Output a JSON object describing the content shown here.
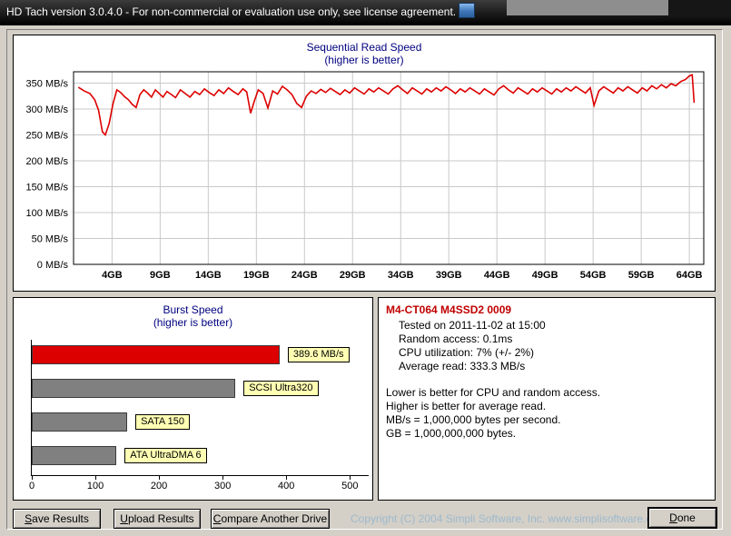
{
  "window": {
    "title": "HD Tach version 3.0.4.0  - For non-commercial or evaluation use only, see license agreement."
  },
  "chart_data": [
    {
      "type": "line",
      "title": "Sequential Read Speed",
      "subtitle": "(higher is better)",
      "color": "#dd0000",
      "ylim": [
        0,
        372
      ],
      "xlim": [
        0,
        65.5
      ],
      "yticks": [
        0,
        50,
        100,
        150,
        200,
        250,
        300,
        350
      ],
      "ytick_suffix": " MB/s",
      "xticks": [
        4,
        9,
        14,
        19,
        24,
        29,
        34,
        39,
        44,
        49,
        54,
        59,
        64
      ],
      "xtick_suffix": "GB",
      "grid": true,
      "points": [
        [
          0.5,
          342
        ],
        [
          1.1,
          335
        ],
        [
          1.7,
          330
        ],
        [
          2.2,
          318
        ],
        [
          2.6,
          298
        ],
        [
          3.0,
          256
        ],
        [
          3.3,
          250
        ],
        [
          3.7,
          272
        ],
        [
          4.1,
          310
        ],
        [
          4.5,
          337
        ],
        [
          4.9,
          332
        ],
        [
          5.3,
          324
        ],
        [
          5.7,
          318
        ],
        [
          6.1,
          309
        ],
        [
          6.5,
          303
        ],
        [
          6.9,
          328
        ],
        [
          7.3,
          337
        ],
        [
          7.7,
          331
        ],
        [
          8.1,
          323
        ],
        [
          8.5,
          337
        ],
        [
          8.9,
          330
        ],
        [
          9.3,
          323
        ],
        [
          9.7,
          334
        ],
        [
          10.1,
          329
        ],
        [
          10.6,
          322
        ],
        [
          11.1,
          337
        ],
        [
          11.6,
          330
        ],
        [
          12.1,
          323
        ],
        [
          12.6,
          334
        ],
        [
          13.1,
          328
        ],
        [
          13.6,
          339
        ],
        [
          14.1,
          332
        ],
        [
          14.6,
          326
        ],
        [
          15.1,
          337
        ],
        [
          15.6,
          330
        ],
        [
          16.1,
          341
        ],
        [
          16.6,
          334
        ],
        [
          17.1,
          328
        ],
        [
          17.6,
          339
        ],
        [
          18.0,
          333
        ],
        [
          18.4,
          292
        ],
        [
          18.8,
          316
        ],
        [
          19.2,
          337
        ],
        [
          19.7,
          330
        ],
        [
          20.2,
          302
        ],
        [
          20.7,
          335
        ],
        [
          21.2,
          329
        ],
        [
          21.7,
          344
        ],
        [
          22.2,
          337
        ],
        [
          22.7,
          328
        ],
        [
          23.2,
          311
        ],
        [
          23.7,
          303
        ],
        [
          24.2,
          325
        ],
        [
          24.7,
          335
        ],
        [
          25.2,
          330
        ],
        [
          25.7,
          338
        ],
        [
          26.2,
          332
        ],
        [
          26.7,
          340
        ],
        [
          27.2,
          334
        ],
        [
          27.7,
          328
        ],
        [
          28.2,
          337
        ],
        [
          28.7,
          331
        ],
        [
          29.2,
          341
        ],
        [
          29.7,
          335
        ],
        [
          30.2,
          329
        ],
        [
          30.7,
          339
        ],
        [
          31.2,
          333
        ],
        [
          31.7,
          341
        ],
        [
          32.2,
          335
        ],
        [
          32.7,
          329
        ],
        [
          33.2,
          339
        ],
        [
          33.7,
          345
        ],
        [
          34.2,
          337
        ],
        [
          34.7,
          330
        ],
        [
          35.2,
          341
        ],
        [
          35.7,
          335
        ],
        [
          36.2,
          329
        ],
        [
          36.7,
          339
        ],
        [
          37.2,
          333
        ],
        [
          37.7,
          341
        ],
        [
          38.2,
          335
        ],
        [
          38.7,
          343
        ],
        [
          39.2,
          337
        ],
        [
          39.7,
          330
        ],
        [
          40.2,
          339
        ],
        [
          40.7,
          333
        ],
        [
          41.2,
          341
        ],
        [
          41.7,
          335
        ],
        [
          42.2,
          329
        ],
        [
          42.7,
          339
        ],
        [
          43.2,
          333
        ],
        [
          43.7,
          327
        ],
        [
          44.2,
          339
        ],
        [
          44.7,
          345
        ],
        [
          45.2,
          337
        ],
        [
          45.7,
          331
        ],
        [
          46.2,
          341
        ],
        [
          46.7,
          335
        ],
        [
          47.2,
          329
        ],
        [
          47.7,
          339
        ],
        [
          48.2,
          333
        ],
        [
          48.7,
          341
        ],
        [
          49.2,
          335
        ],
        [
          49.7,
          329
        ],
        [
          50.2,
          339
        ],
        [
          50.7,
          333
        ],
        [
          51.2,
          341
        ],
        [
          51.7,
          335
        ],
        [
          52.2,
          343
        ],
        [
          52.7,
          337
        ],
        [
          53.2,
          331
        ],
        [
          53.7,
          341
        ],
        [
          54.1,
          307
        ],
        [
          54.6,
          335
        ],
        [
          55.1,
          343
        ],
        [
          55.6,
          337
        ],
        [
          56.1,
          331
        ],
        [
          56.6,
          341
        ],
        [
          57.1,
          335
        ],
        [
          57.6,
          343
        ],
        [
          58.1,
          337
        ],
        [
          58.6,
          331
        ],
        [
          59.1,
          341
        ],
        [
          59.6,
          335
        ],
        [
          60.1,
          345
        ],
        [
          60.6,
          339
        ],
        [
          61.1,
          347
        ],
        [
          61.6,
          341
        ],
        [
          62.1,
          349
        ],
        [
          62.6,
          345
        ],
        [
          63.1,
          353
        ],
        [
          63.6,
          357
        ],
        [
          64.0,
          364
        ],
        [
          64.3,
          366
        ],
        [
          64.5,
          312
        ]
      ]
    },
    {
      "type": "bar",
      "orientation": "horizontal",
      "title": "Burst Speed",
      "subtitle": "(higher is better)",
      "xlim": [
        0,
        531
      ],
      "xticks": [
        0,
        100,
        200,
        300,
        400,
        500
      ],
      "bars": [
        {
          "label": "389.6 MB/s",
          "value": 389.6,
          "color": "#dd0000"
        },
        {
          "label": "SCSI Ultra320",
          "value": 320,
          "color": "#808080"
        },
        {
          "label": "SATA 150",
          "value": 150,
          "color": "#808080"
        },
        {
          "label": "ATA UltraDMA 6",
          "value": 133,
          "color": "#808080"
        }
      ]
    }
  ],
  "drive_info": {
    "model": "M4-CT064 M4SSD2 0009",
    "tested": "Tested on 2011-11-02 at 15:00",
    "random_access": "Random access: 0.1ms",
    "cpu_utilization": "CPU utilization: 7% (+/- 2%)",
    "average_read": "Average read: 333.3 MB/s",
    "notes": [
      "Lower is better for CPU and random access.",
      "Higher is better for average read.",
      "MB/s = 1,000,000 bytes per second.",
      "GB = 1,000,000,000 bytes."
    ]
  },
  "buttons": {
    "save": {
      "u": "S",
      "rest": "ave Results"
    },
    "upload": {
      "u": "U",
      "rest": "pload Results"
    },
    "compare": {
      "u": "C",
      "rest": "ompare Another Drive"
    },
    "done": {
      "u": "D",
      "rest": "one"
    }
  },
  "footer": {
    "copyright": "Copyright (C) 2004 Simpli Software, Inc. www.simplisoftware.com"
  }
}
